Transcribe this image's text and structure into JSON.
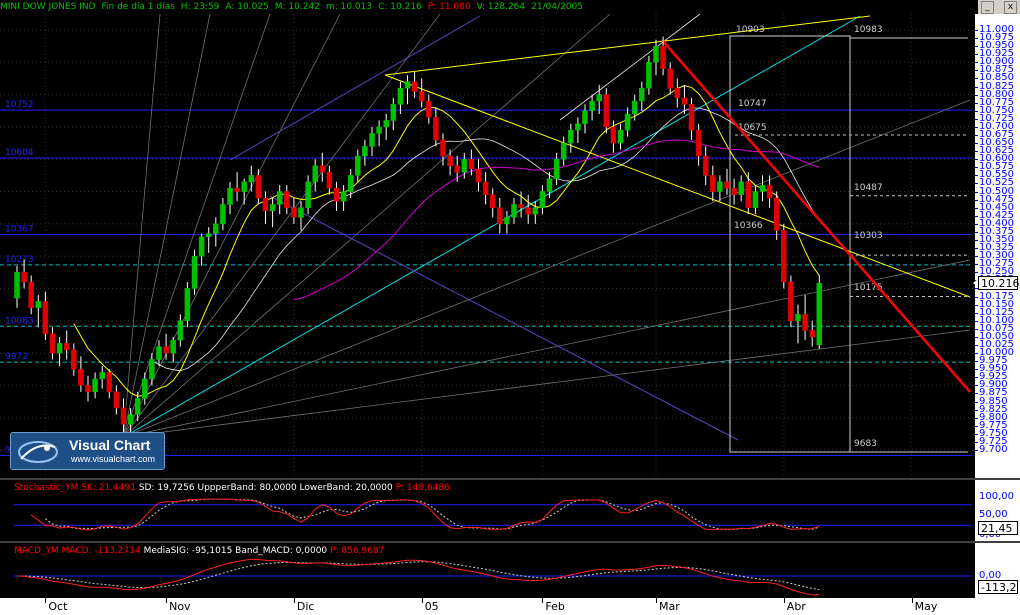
{
  "window": {
    "close_label": "x",
    "min_label": "_"
  },
  "infobar": {
    "symbol": "MINI DOW JONES IND",
    "period": "Fin de día 1 días",
    "time": "H: 23:59",
    "open": "A: 10.025",
    "high": "M: 10.242",
    "low": "m: 10.013",
    "close": "C: 10.216",
    "points": "P: 11.080",
    "volume": "V: 128.264",
    "date": "21/04/2005"
  },
  "logo": {
    "title": "Visual Chart",
    "url": "www.visualchart.com"
  },
  "colors": {
    "up": "#00c000",
    "down": "#e00000",
    "wick": "#ffffff",
    "level": "#0000d0",
    "yellow": "#ffff00",
    "cyan": "#00e0e0",
    "magenta": "#d000d0",
    "white": "#e8e8e8",
    "gray": "#808080",
    "trend_red": "#ff0000",
    "purple": "#6040c0"
  },
  "chart_data": [
    {
      "type": "candlestick",
      "title": "MINI DOW JONES IND",
      "xlabel": "",
      "ylabel": "",
      "ylim": [
        9.7,
        11.0
      ],
      "current_price": "10.216",
      "months": [
        "Oct",
        "Nov",
        "Dic",
        "05",
        "Feb",
        "Mar",
        "Abr",
        "May"
      ],
      "candles": [
        [
          10.17,
          10.27,
          10.14,
          10.25
        ],
        [
          10.25,
          10.29,
          10.2,
          10.22
        ],
        [
          10.22,
          10.24,
          10.12,
          10.14
        ],
        [
          10.14,
          10.18,
          10.08,
          10.16
        ],
        [
          10.16,
          10.19,
          10.04,
          10.06
        ],
        [
          10.06,
          10.08,
          9.98,
          10.0
        ],
        [
          10.0,
          10.05,
          9.96,
          10.03
        ],
        [
          10.03,
          10.07,
          9.98,
          10.01
        ],
        [
          10.01,
          10.03,
          9.93,
          9.95
        ],
        [
          9.95,
          9.99,
          9.88,
          9.9
        ],
        [
          9.9,
          9.93,
          9.85,
          9.88
        ],
        [
          9.88,
          9.94,
          9.86,
          9.92
        ],
        [
          9.92,
          9.96,
          9.89,
          9.94
        ],
        [
          9.94,
          9.95,
          9.86,
          9.88
        ],
        [
          9.88,
          9.9,
          9.81,
          9.83
        ],
        [
          9.83,
          9.86,
          9.75,
          9.78
        ],
        [
          9.78,
          9.83,
          9.74,
          9.81
        ],
        [
          9.81,
          9.88,
          9.79,
          9.86
        ],
        [
          9.86,
          9.94,
          9.84,
          9.92
        ],
        [
          9.92,
          10.0,
          9.9,
          9.98
        ],
        [
          9.98,
          10.04,
          9.96,
          10.02
        ],
        [
          10.02,
          10.06,
          9.98,
          10.0
        ],
        [
          10.0,
          10.05,
          9.97,
          10.04
        ],
        [
          10.04,
          10.12,
          10.02,
          10.1
        ],
        [
          10.1,
          10.22,
          10.08,
          10.2
        ],
        [
          10.2,
          10.32,
          10.18,
          10.3
        ],
        [
          10.3,
          10.37,
          10.27,
          10.36
        ],
        [
          10.36,
          10.39,
          10.31,
          10.37
        ],
        [
          10.37,
          10.42,
          10.33,
          10.4
        ],
        [
          10.4,
          10.48,
          10.38,
          10.46
        ],
        [
          10.46,
          10.53,
          10.43,
          10.51
        ],
        [
          10.51,
          10.56,
          10.47,
          10.5
        ],
        [
          10.5,
          10.54,
          10.46,
          10.53
        ],
        [
          10.53,
          10.58,
          10.5,
          10.55
        ],
        [
          10.55,
          10.57,
          10.46,
          10.48
        ],
        [
          10.48,
          10.5,
          10.4,
          10.44
        ],
        [
          10.44,
          10.48,
          10.39,
          10.46
        ],
        [
          10.46,
          10.52,
          10.43,
          10.5
        ],
        [
          10.5,
          10.52,
          10.43,
          10.45
        ],
        [
          10.45,
          10.48,
          10.4,
          10.42
        ],
        [
          10.42,
          10.47,
          10.38,
          10.45
        ],
        [
          10.45,
          10.55,
          10.43,
          10.53
        ],
        [
          10.53,
          10.6,
          10.5,
          10.58
        ],
        [
          10.58,
          10.62,
          10.53,
          10.56
        ],
        [
          10.56,
          10.58,
          10.49,
          10.51
        ],
        [
          10.51,
          10.53,
          10.44,
          10.47
        ],
        [
          10.47,
          10.52,
          10.44,
          10.5
        ],
        [
          10.5,
          10.57,
          10.48,
          10.55
        ],
        [
          10.55,
          10.63,
          10.53,
          10.61
        ],
        [
          10.61,
          10.66,
          10.58,
          10.64
        ],
        [
          10.64,
          10.7,
          10.61,
          10.68
        ],
        [
          10.68,
          10.72,
          10.64,
          10.7
        ],
        [
          10.7,
          10.74,
          10.66,
          10.72
        ],
        [
          10.72,
          10.79,
          10.69,
          10.77
        ],
        [
          10.77,
          10.84,
          10.74,
          10.82
        ],
        [
          10.82,
          10.86,
          10.77,
          10.84
        ],
        [
          10.84,
          10.87,
          10.79,
          10.81
        ],
        [
          10.81,
          10.85,
          10.76,
          10.78
        ],
        [
          10.78,
          10.8,
          10.71,
          10.73
        ],
        [
          10.73,
          10.76,
          10.64,
          10.66
        ],
        [
          10.66,
          10.68,
          10.58,
          10.61
        ],
        [
          10.61,
          10.63,
          10.55,
          10.58
        ],
        [
          10.58,
          10.61,
          10.53,
          10.56
        ],
        [
          10.56,
          10.62,
          10.54,
          10.6
        ],
        [
          10.6,
          10.63,
          10.55,
          10.57
        ],
        [
          10.57,
          10.6,
          10.5,
          10.53
        ],
        [
          10.53,
          10.56,
          10.46,
          10.49
        ],
        [
          10.49,
          10.51,
          10.42,
          10.45
        ],
        [
          10.45,
          10.48,
          10.37,
          10.4
        ],
        [
          10.4,
          10.44,
          10.37,
          10.42
        ],
        [
          10.42,
          10.48,
          10.4,
          10.46
        ],
        [
          10.46,
          10.5,
          10.42,
          10.45
        ],
        [
          10.45,
          10.49,
          10.4,
          10.43
        ],
        [
          10.43,
          10.47,
          10.4,
          10.45
        ],
        [
          10.45,
          10.52,
          10.43,
          10.5
        ],
        [
          10.5,
          10.56,
          10.48,
          10.54
        ],
        [
          10.54,
          10.62,
          10.52,
          10.6
        ],
        [
          10.6,
          10.67,
          10.58,
          10.65
        ],
        [
          10.65,
          10.71,
          10.62,
          10.69
        ],
        [
          10.69,
          10.73,
          10.65,
          10.71
        ],
        [
          10.71,
          10.77,
          10.68,
          10.75
        ],
        [
          10.75,
          10.8,
          10.72,
          10.78
        ],
        [
          10.78,
          10.83,
          10.74,
          10.8
        ],
        [
          10.8,
          10.82,
          10.68,
          10.7
        ],
        [
          10.7,
          10.72,
          10.62,
          10.65
        ],
        [
          10.65,
          10.71,
          10.63,
          10.69
        ],
        [
          10.69,
          10.76,
          10.67,
          10.74
        ],
        [
          10.74,
          10.8,
          10.72,
          10.78
        ],
        [
          10.78,
          10.84,
          10.75,
          10.82
        ],
        [
          10.82,
          10.92,
          10.8,
          10.9
        ],
        [
          10.9,
          10.97,
          10.86,
          10.95
        ],
        [
          10.95,
          10.98,
          10.86,
          10.88
        ],
        [
          10.88,
          10.9,
          10.8,
          10.82
        ],
        [
          10.82,
          10.85,
          10.76,
          10.79
        ],
        [
          10.79,
          10.83,
          10.74,
          10.77
        ],
        [
          10.77,
          10.79,
          10.66,
          10.69
        ],
        [
          10.69,
          10.71,
          10.58,
          10.61
        ],
        [
          10.61,
          10.64,
          10.52,
          10.55
        ],
        [
          10.55,
          10.58,
          10.47,
          10.5
        ],
        [
          10.5,
          10.55,
          10.47,
          10.53
        ],
        [
          10.53,
          10.57,
          10.49,
          10.51
        ],
        [
          10.51,
          10.54,
          10.46,
          10.49
        ],
        [
          10.49,
          10.55,
          10.47,
          10.53
        ],
        [
          10.53,
          10.56,
          10.43,
          10.45
        ],
        [
          10.45,
          10.52,
          10.43,
          10.5
        ],
        [
          10.5,
          10.55,
          10.47,
          10.52
        ],
        [
          10.52,
          10.55,
          10.45,
          10.48
        ],
        [
          10.48,
          10.5,
          10.35,
          10.38
        ],
        [
          10.38,
          10.4,
          10.2,
          10.22
        ],
        [
          10.22,
          10.24,
          10.08,
          10.1
        ],
        [
          10.1,
          10.15,
          10.03,
          10.12
        ],
        [
          10.12,
          10.18,
          10.04,
          10.07
        ],
        [
          10.07,
          10.1,
          10.02,
          10.05
        ],
        [
          10.025,
          10.242,
          10.013,
          10.216
        ]
      ],
      "levels": [
        {
          "label": "10752",
          "value": 10.752
        },
        {
          "label": "10604",
          "value": 10.604
        },
        {
          "label": "10367",
          "value": 10.367
        },
        {
          "label": "10273",
          "value": 10.273
        },
        {
          "label": "10083",
          "value": 10.083
        },
        {
          "label": "9972",
          "value": 9.972
        },
        {
          "label": "9683",
          "value": 9.683
        }
      ],
      "box_labels": [
        "10903",
        "10983",
        "10747",
        "10675",
        "10487",
        "10366",
        "10303",
        "10175",
        "9683"
      ],
      "y_ticks": [
        "11.000",
        "10.975",
        "10.950",
        "10.925",
        "10.900",
        "10.875",
        "10.850",
        "10.825",
        "10.800",
        "10.775",
        "10.750",
        "10.725",
        "10.700",
        "10.675",
        "10.650",
        "10.625",
        "10.600",
        "10.575",
        "10.550",
        "10.525",
        "10.500",
        "10.475",
        "10.450",
        "10.425",
        "10.400",
        "10.375",
        "10.350",
        "10.325",
        "10.300",
        "10.275",
        "10.250",
        "10.225",
        "10.200",
        "10.175",
        "10.150",
        "10.125",
        "10.100",
        "10.075",
        "10.050",
        "10.025",
        "10.000",
        "9.975",
        "9.950",
        "9.925",
        "9.900",
        "9.875",
        "9.850",
        "9.825",
        "9.800",
        "9.775",
        "9.750",
        "9.725",
        "9.700"
      ]
    },
    {
      "type": "line",
      "title": "Stochastic_YM",
      "legend": [
        "SK: 21,4491",
        "SD: 19,7256",
        "UppperBand: 80,0000",
        "LowerBand: 20,0000",
        "P: 148,6486"
      ],
      "ylim": [
        0,
        100
      ],
      "y_ticks": [
        "100,00",
        "50,00",
        "0,00"
      ],
      "current_value": "21,45",
      "upper_band": 80,
      "lower_band": 20
    },
    {
      "type": "line",
      "title": "MACD_YM",
      "legend": [
        "MACD: -113,2714",
        "MediaSIG: -95,1015",
        "Band_MACD: 0,0000",
        "P: 856,9687"
      ],
      "y_ticks": [
        "0,00"
      ],
      "current_value": "-113,2",
      "band": 0
    }
  ]
}
